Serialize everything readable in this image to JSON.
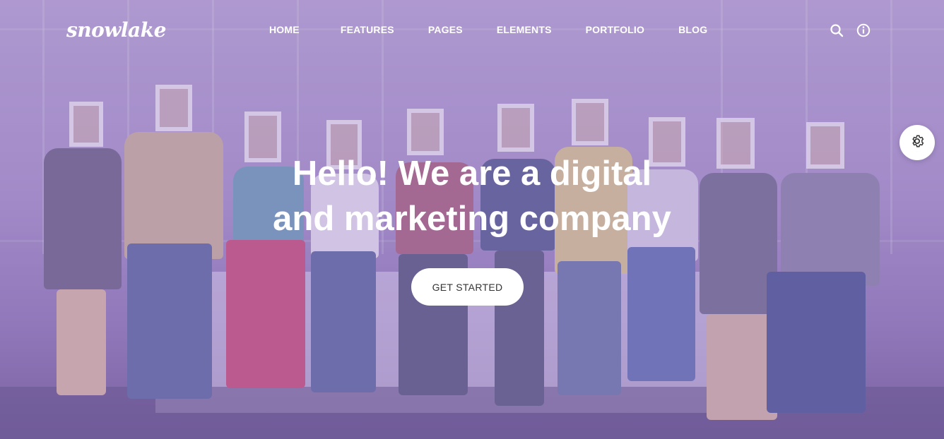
{
  "header": {
    "logo": "snowlake",
    "nav": [
      "HOME",
      "FEATURES",
      "PAGES",
      "ELEMENTS",
      "PORTFOLIO",
      "BLOG"
    ]
  },
  "icons": {
    "search": "search-icon",
    "info": "info-icon",
    "settings": "gear-icon"
  },
  "hero": {
    "headline_line1": "Hello! We are a digital",
    "headline_line2": "and marketing company",
    "cta_label": "GET STARTED"
  },
  "colors": {
    "overlay": "#a58fcb",
    "text": "#ffffff",
    "button_bg": "#ffffff",
    "button_text": "#333333"
  }
}
